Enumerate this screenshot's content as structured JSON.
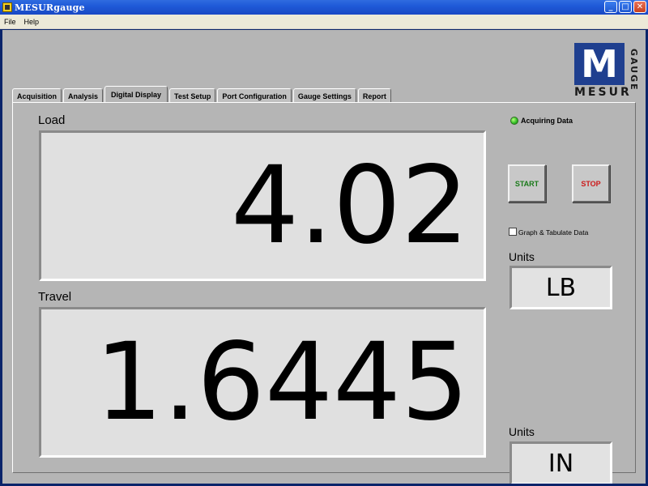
{
  "window": {
    "title": "MESURgauge",
    "minimize_glyph": "_",
    "maximize_glyph": "□",
    "close_glyph": "✕"
  },
  "menu": {
    "file": "File",
    "help": "Help"
  },
  "logo": {
    "letter": "M",
    "wordmark": "MESUR",
    "sub": "GAUGE",
    "trademark": "TM"
  },
  "tabs": [
    {
      "label": "Acquisition"
    },
    {
      "label": "Analysis"
    },
    {
      "label": "Digital Display"
    },
    {
      "label": "Test Setup"
    },
    {
      "label": "Port Configuration"
    },
    {
      "label": "Gauge Settings"
    },
    {
      "label": "Report"
    }
  ],
  "active_tab": "Digital Display",
  "load": {
    "label": "Load",
    "value": "4.02",
    "units_label": "Units",
    "units": "LB"
  },
  "travel": {
    "label": "Travel",
    "value": "1.6445",
    "units_label": "Units",
    "units": "IN"
  },
  "status": {
    "acquiring_label": "Acquiring Data",
    "led_color": "#36c22a"
  },
  "controls": {
    "start_label": "START",
    "stop_label": "STOP",
    "graph_tabulate_label": "Graph & Tabulate Data",
    "graph_tabulate_checked": false
  },
  "colors": {
    "titlebar": "#1f5ad8",
    "panel_bg": "#b5b5b5",
    "display_bg": "#e0e0e0",
    "logo_blue": "#1f3f8f",
    "start_text": "#1a7a1a",
    "stop_text": "#cc1a1a"
  }
}
